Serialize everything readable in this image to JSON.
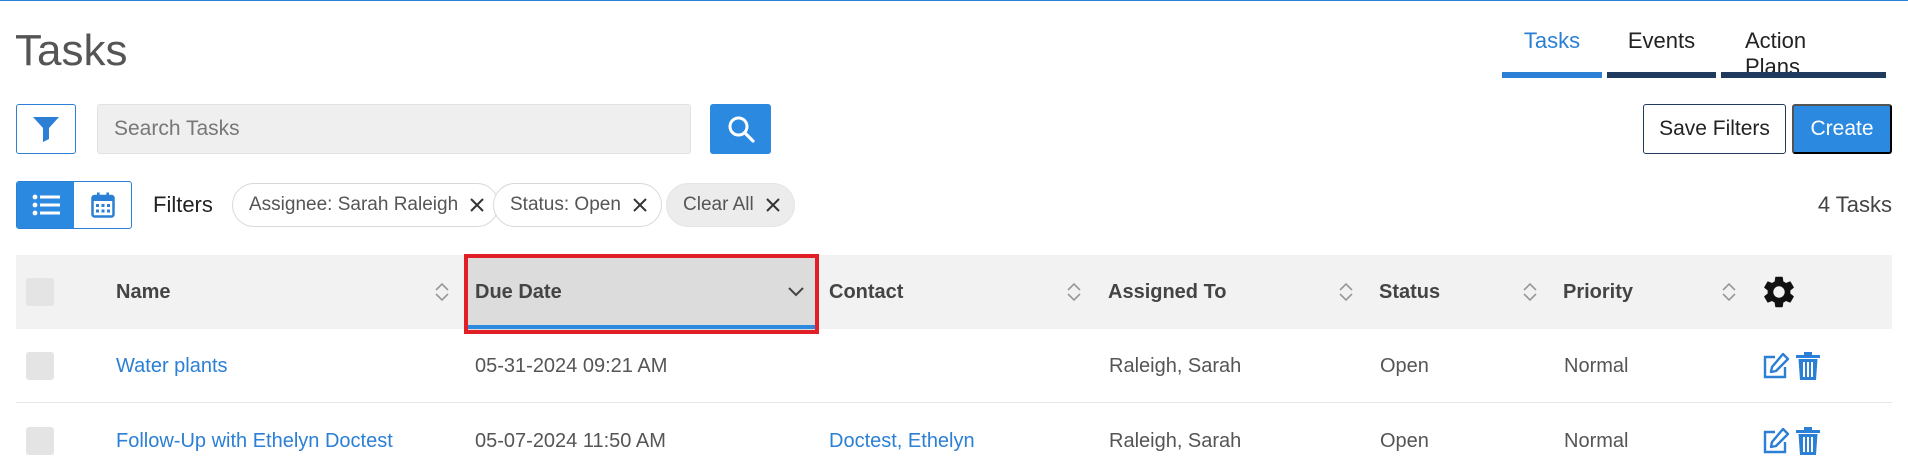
{
  "page": {
    "title": "Tasks"
  },
  "tabs": [
    {
      "label": "Tasks",
      "active": true
    },
    {
      "label": "Events",
      "active": false
    },
    {
      "label": "Action Plans",
      "active": false
    }
  ],
  "toolbar": {
    "filter_icon": "funnel-icon",
    "search_placeholder": "Search Tasks",
    "search_icon": "magnifier-icon",
    "save_filters_label": "Save Filters",
    "create_label": "Create"
  },
  "view_toggle": {
    "list_icon": "list-icon",
    "calendar_icon": "calendar-icon",
    "active": "list"
  },
  "filters": {
    "label": "Filters",
    "chips": [
      {
        "text": "Assignee: Sarah Raleigh"
      },
      {
        "text": "Status: Open"
      }
    ],
    "clear_all": "Clear All",
    "count_text": "4 Tasks"
  },
  "table": {
    "columns": [
      "Name",
      "Due Date",
      "Contact",
      "Assigned To",
      "Status",
      "Priority"
    ],
    "sorted_column": "Due Date",
    "settings_icon": "gear-icon",
    "rows": [
      {
        "name": "Water plants",
        "due_date": "05-31-2024 09:21 AM",
        "contact": "",
        "assigned_to": "Raleigh, Sarah",
        "status": "Open",
        "priority": "Normal"
      },
      {
        "name": "Follow-Up with Ethelyn Doctest",
        "due_date": "05-07-2024 11:50 AM",
        "contact": "Doctest, Ethelyn",
        "assigned_to": "Raleigh, Sarah",
        "status": "Open",
        "priority": "Normal"
      }
    ]
  },
  "colors": {
    "accent": "#2b8ae0",
    "dark_navy": "#203a5e",
    "highlight": "#e01f26"
  }
}
